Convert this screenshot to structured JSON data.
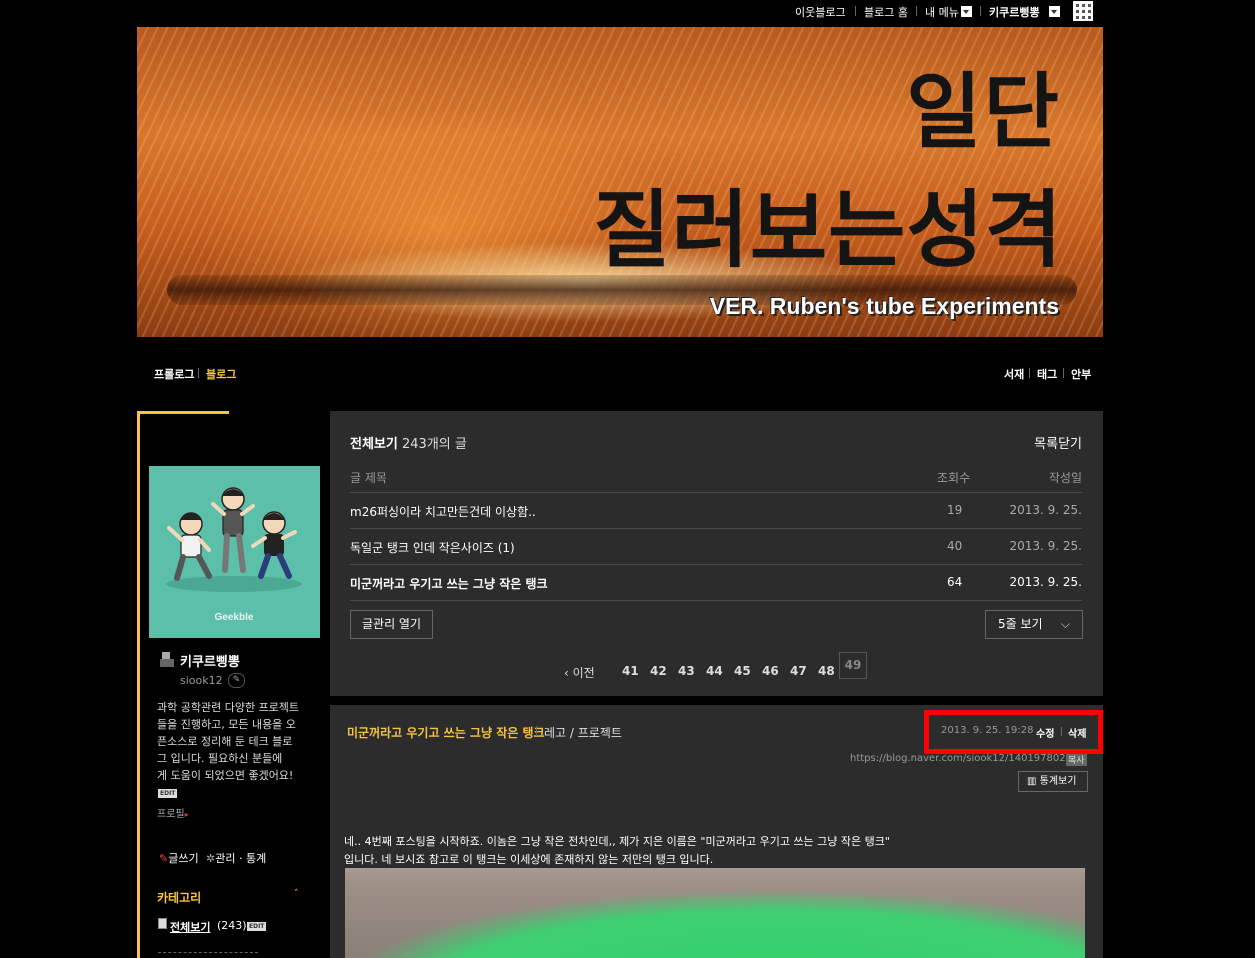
{
  "gnb": {
    "neighbor_blog": "이웃블로그",
    "blog_home": "블로그 홈",
    "my_menu": "내 메뉴",
    "user": "키쿠르삥뽕"
  },
  "banner": {
    "title_line1": "일단",
    "title_line2": "질러보는성격",
    "subtitle": "VER. Ruben's tube Experiments"
  },
  "menu": {
    "prologue": "프롤로그",
    "blog": "블로그",
    "library": "서재",
    "tag": "태그",
    "guestbook": "안부"
  },
  "profile": {
    "name": "키쿠르삥뽕",
    "id": "siook12",
    "desc_lines": [
      "과학 공학관련 다양한 프로젝트",
      "들을 진행하고, 모든 내용을 오",
      "픈소스로 정리해 둔 테크 블로",
      "그 입니다. 필요하신 분들에",
      "게 도움이 되었으면 좋겠어요!"
    ],
    "edit_badge": "EDIT",
    "profile_link": "프로필",
    "write": "글쓰기",
    "admin_stats": "관리 · 통계",
    "category_header": "카테고리",
    "all_posts_label": "전체보기",
    "all_posts_count": "(243)",
    "avatar_logo": "Geekble"
  },
  "post_list": {
    "title_label": "전체보기",
    "count": "243개의 글",
    "close": "목록닫기",
    "col_title": "글 제목",
    "col_views": "조회수",
    "col_date": "작성일",
    "rows": [
      {
        "title": "m26퍼싱이라 치고만든건데 이상함..",
        "views": "19",
        "date": "2013. 9. 25."
      },
      {
        "title": "독일군 탱크 인데 작은사이즈 (1)",
        "views": "40",
        "date": "2013. 9. 25."
      },
      {
        "title": "미군꺼라고 우기고 쓰는 그냥 작은 탱크",
        "views": "64",
        "date": "2013. 9. 25."
      }
    ],
    "manage_button": "글관리 열기",
    "rows_select": "5줄 보기",
    "prev": "이전",
    "pages": [
      "41",
      "42",
      "43",
      "44",
      "45",
      "46",
      "47",
      "48",
      "49"
    ],
    "current_page": "49"
  },
  "post": {
    "title": "미군꺼라고 우기고 쓰는 그냥 작은 탱크",
    "category": "레고 / 프로젝트",
    "datetime": "2013. 9. 25. 19:28",
    "edit": "수정",
    "delete": "삭제",
    "url": "https://blog.naver.com/siook12/140197802163",
    "copy": "복사",
    "stats": "통계보기",
    "body_line1": "네.. 4번째 포스팅을 시작하죠. 이놈은 그냥 작은 전차인데,, 제가 지은 이름은 \"미군꺼라고 우기고 쓰는 그냥 작은 탱크\"",
    "body_line2": "입니다. 네 보시죠 참고로 이 탱크는 이세상에 존재하지 않는 저만의 탱크 입니다."
  },
  "colors": {
    "accent": "#f6c343",
    "panel": "#2c2c2c",
    "highlight": "#ff0000",
    "avatar_bg": "#5bbfaa"
  }
}
